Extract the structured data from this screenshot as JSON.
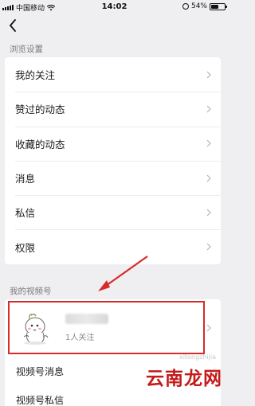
{
  "status_bar": {
    "carrier": "中国移动",
    "time": "14:02",
    "battery_text": "54%",
    "battery_level": 0.54,
    "icons": [
      "signal-icon",
      "wifi-icon",
      "orientation-lock-icon",
      "battery-icon"
    ]
  },
  "nav": {
    "back_icon": "chevron-left-icon"
  },
  "browse_settings": {
    "title": "浏览设置",
    "items": [
      {
        "label": "我的关注"
      },
      {
        "label": "赞过的动态"
      },
      {
        "label": "收藏的动态"
      },
      {
        "label": "消息"
      },
      {
        "label": "私信"
      },
      {
        "label": "权限"
      }
    ]
  },
  "channels": {
    "title": "我的视频号",
    "account": {
      "followers": "1人关注",
      "avatar_icon": "cartoon-avatar-icon"
    },
    "items": [
      {
        "label": "视频号消息"
      },
      {
        "label": "视频号私信"
      }
    ]
  },
  "annotation": {
    "color": "#d82a2a"
  },
  "watermark": {
    "text": "云南龙网",
    "url": "xitongzhijia"
  }
}
